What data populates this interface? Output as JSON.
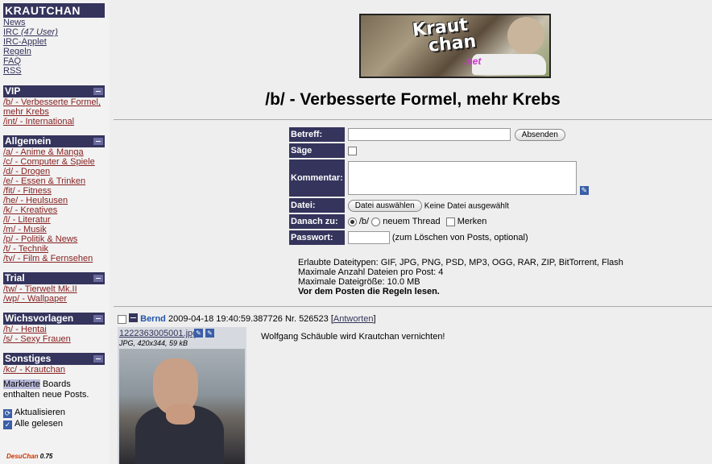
{
  "sidebar": {
    "site_name": "KRAUTCHAN",
    "top_links": [
      {
        "label": "News"
      },
      {
        "label": "IRC",
        "extra": "(47 User)"
      },
      {
        "label": "IRC-Applet"
      },
      {
        "label": "Regeln"
      },
      {
        "label": "FAQ"
      },
      {
        "label": "RSS"
      }
    ],
    "sections": [
      {
        "title": "VIP",
        "items": [
          "/b/ - Verbesserte Formel,",
          "mehr Krebs",
          "/int/ - International"
        ]
      },
      {
        "title": "Allgemein",
        "items": [
          "/a/ - Anime & Manga",
          "/c/ - Computer & Spiele",
          "/d/ - Drogen",
          "/e/ - Essen & Trinken",
          "/fit/ - Fitness",
          "/he/ - Heulsusen",
          "/k/ - Kreatives",
          "/l/ - Literatur",
          "/m/ - Musik",
          "/p/ - Politik & News",
          "/t/ - Technik",
          "/tv/ - Film & Fernsehen"
        ]
      },
      {
        "title": "Trial",
        "items": [
          "/tw/ - Tierwelt Mk.II",
          "/wp/ - Wallpaper"
        ]
      },
      {
        "title": "Wichsvorlagen",
        "items": [
          "/h/ - Hentai",
          "/s/ - Sexy Frauen"
        ]
      },
      {
        "title": "Sonstiges",
        "items": [
          "/kc/ - Krautchan"
        ]
      }
    ],
    "legend_highlight": "Markierte",
    "legend_rest1": " Boards",
    "legend_rest2": "enthalten neue Posts.",
    "refresh_label": "Aktualisieren",
    "all_read_label": "Alle gelesen",
    "version_brand": "DesuChan",
    "version_number": "0.75"
  },
  "logo": {
    "line1": "Kraut",
    "line2": "chan",
    "suffix": ".net"
  },
  "board_title": "/b/ - Verbesserte Formel, mehr Krebs",
  "form": {
    "subject_label": "Betreff:",
    "submit_label": "Absenden",
    "sage_label": "Säge",
    "comment_label": "Kommentar:",
    "file_label": "Datei:",
    "file_button": "Datei auswählen",
    "file_status": "Keine Datei ausgewählt",
    "after_label": "Danach zu:",
    "after_option1": "/b/",
    "after_option2": "neuem Thread",
    "remember_label": "Merken",
    "password_label": "Passwort:",
    "password_hint": "(zum Löschen von Posts, optional)"
  },
  "rules": {
    "line1": "Erlaubte Dateitypen: GIF, JPG, PNG, PSD, MP3, OGG, RAR, ZIP, BitTorrent, Flash",
    "line2": "Maximale Anzahl Dateien pro Post: 4",
    "line3": "Maximale Dateigröße: 10.0 MB",
    "line4": "Vor dem Posten die Regeln lesen."
  },
  "post": {
    "name": "Bernd",
    "datetime": "2009-04-18 19:40:59.387726",
    "number_prefix": "Nr.",
    "number": "526523",
    "reply_open": "[",
    "reply_label": "Antworten",
    "reply_close": "]",
    "file_name": "1222363005001.jpg",
    "file_info": "JPG, 420x344, 59 kB",
    "text": "Wolfgang Schäuble wird Krautchan vernichten!"
  }
}
